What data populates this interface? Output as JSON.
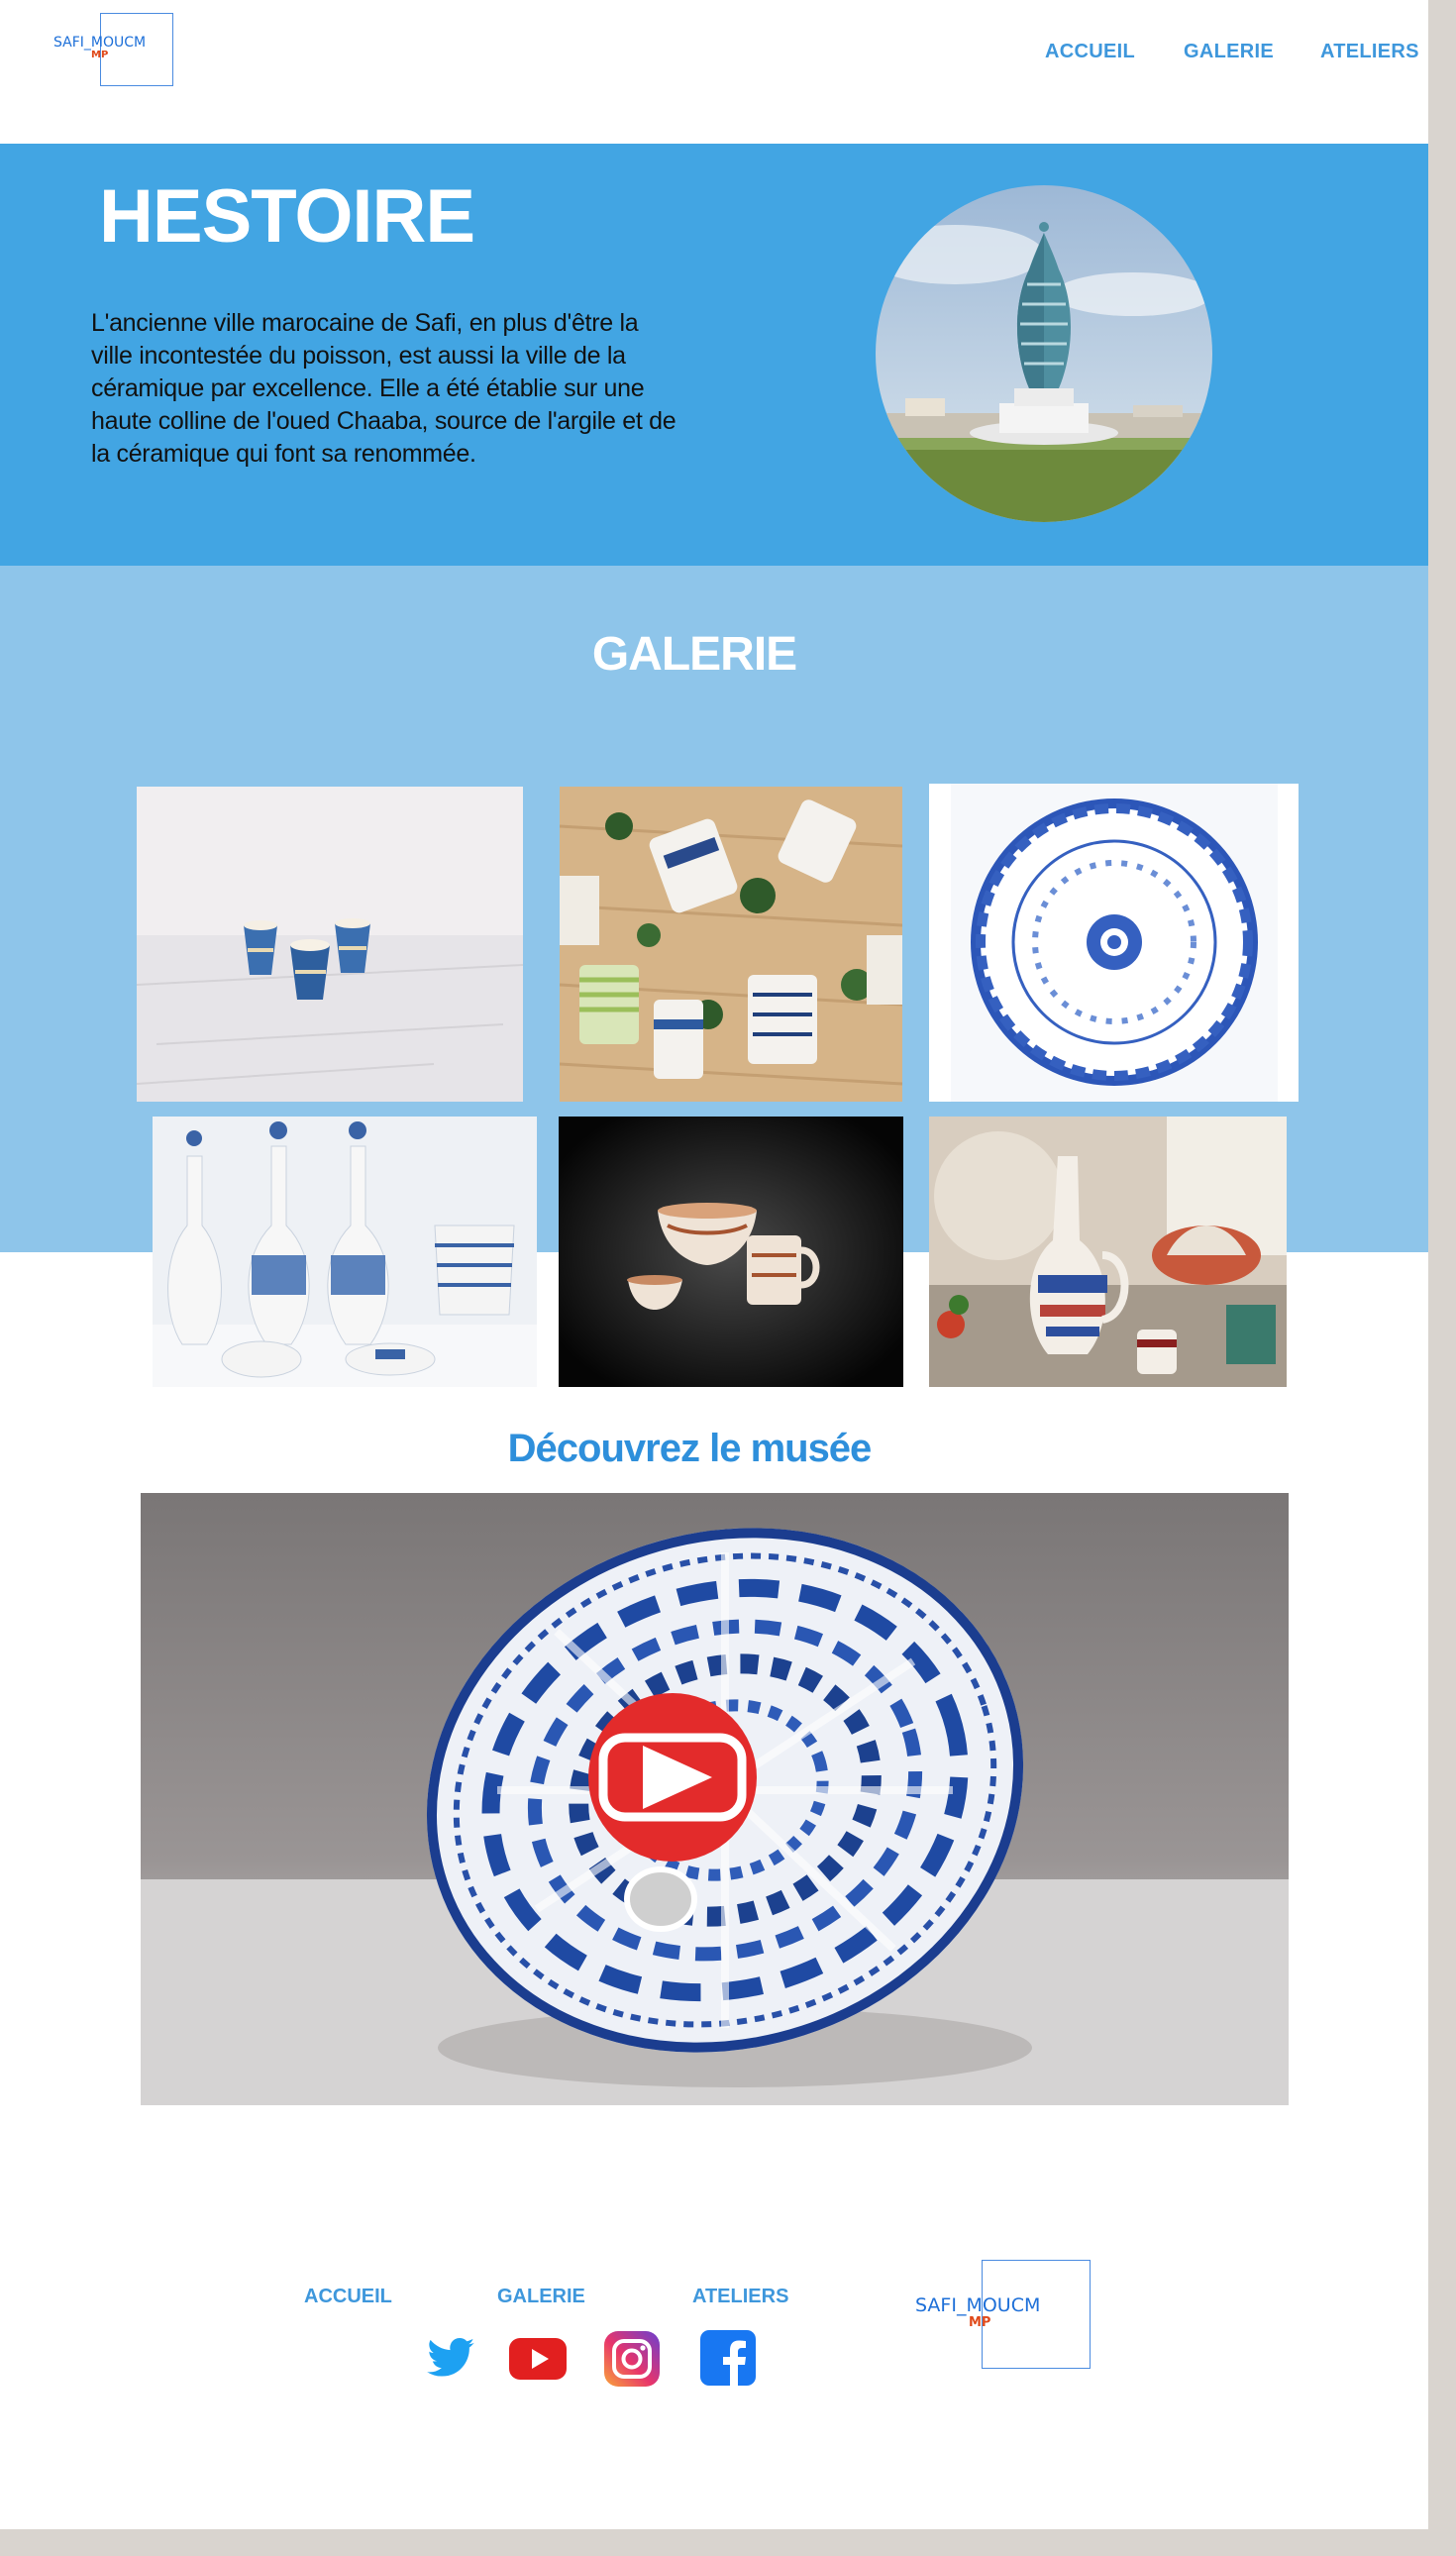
{
  "header": {
    "logo": {
      "text": "SAFI_MOUCM",
      "sub": "MP"
    },
    "nav": [
      "ACCUEIL",
      "GALERIE",
      "ATELIERS"
    ]
  },
  "hero": {
    "title": "HESTOIRE",
    "text": "L'ancienne ville marocaine de Safi, en plus d'être la ville incontestée du poisson, est aussi la ville de la céramique par excellence. Elle a été établie sur une haute colline de l'oued Chaaba, source de l'argile et de la céramique qui font sa renommée."
  },
  "gallery": {
    "title": "GALERIE",
    "images": [
      "ceramic-cups",
      "painted-mugs",
      "blue-floral-plate",
      "decanters-set",
      "brown-bowls",
      "ceramic-jug"
    ]
  },
  "museum": {
    "title": "Découvrez le musée",
    "video_icon": "youtube-play-icon"
  },
  "footer": {
    "nav": [
      "ACCUEIL",
      "GALERIE",
      "ATELIERS"
    ],
    "social": [
      "twitter-icon",
      "youtube-icon",
      "instagram-icon",
      "facebook-icon"
    ],
    "logo": {
      "text": "SAFI_MOUCM",
      "sub": "MP"
    }
  },
  "colors": {
    "hero_bg": "#42a5e3",
    "gallery_bg": "#8ec5ea",
    "accent": "#3e97dc"
  }
}
